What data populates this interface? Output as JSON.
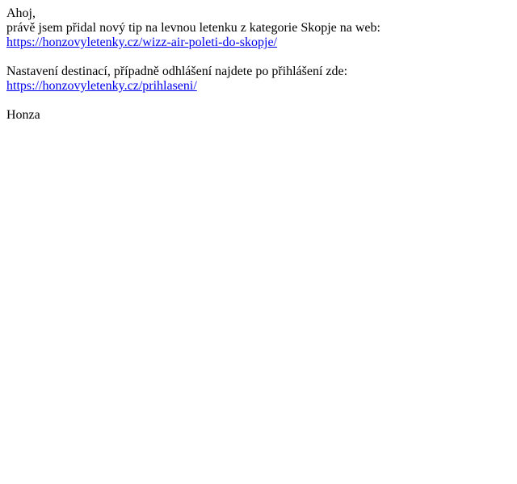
{
  "email": {
    "greeting": "Ahoj,",
    "intro": "právě jsem přidal nový tip na levnou letenku z kategorie Skopje na web:",
    "tip_link": "https://honzovyletenky.cz/wizz-air-poleti-do-skopje/",
    "settings_text": "Nastavení destinací, případně odhlášení najdete po přihlášení zde:",
    "login_link": "https://honzovyletenky.cz/prihlaseni/",
    "signature": "Honza"
  },
  "colors": {
    "text": "#000000",
    "link": "#0000ee",
    "background": "#ffffff"
  }
}
